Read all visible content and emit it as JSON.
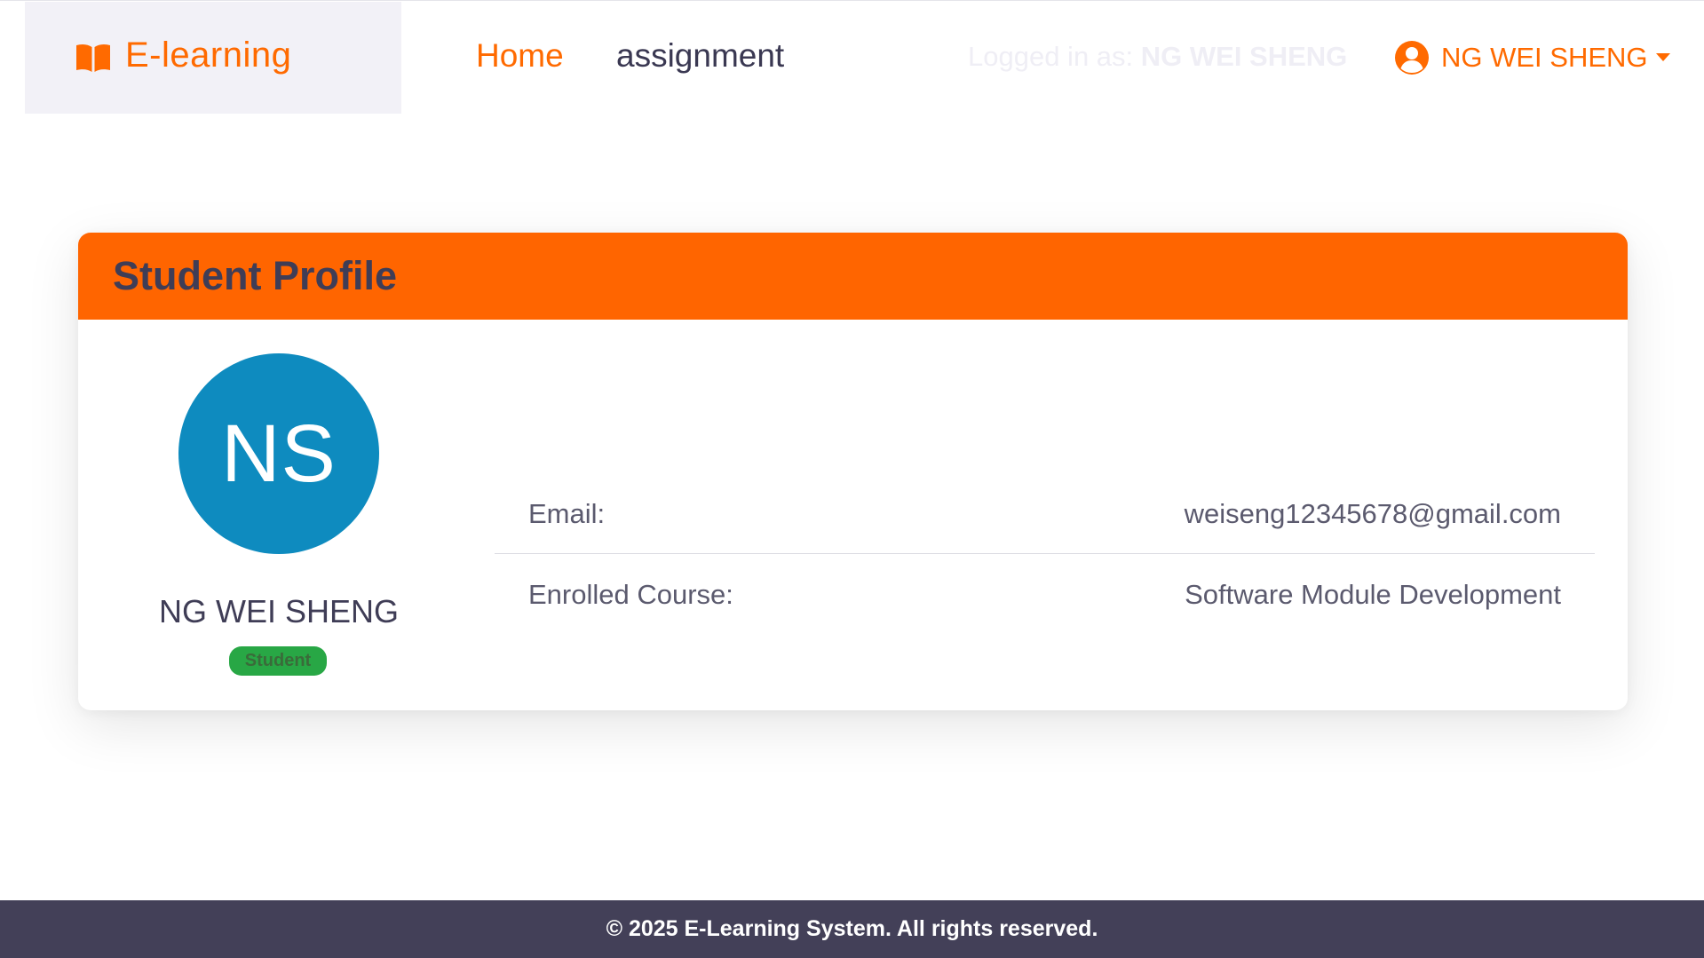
{
  "brand": {
    "name": "E-learning",
    "icon": "book-open-icon"
  },
  "nav": {
    "items": [
      {
        "label": "Home",
        "active": true
      },
      {
        "label": "assignment",
        "active": false
      }
    ]
  },
  "session": {
    "logged_in_prefix": "Logged in as:",
    "logged_in_user": "NG WEI SHENG",
    "user_menu_label": "NG WEI SHENG",
    "user_icon": "user-circle-icon"
  },
  "profile": {
    "title": "Student Profile",
    "initials": "NS",
    "name": "NG WEI SHENG",
    "role": "Student",
    "fields": [
      {
        "label": "Email:",
        "value": "weiseng12345678@gmail.com"
      },
      {
        "label": "Enrolled Course:",
        "value": "Software Module Development"
      }
    ]
  },
  "footer": {
    "text": "© 2025 E-Learning System. All rights reserved."
  },
  "colors": {
    "accent": "#ff6a00",
    "header_bar": "#ff6500",
    "avatar_bg": "#0e8bbf",
    "badge_bg": "#28a745",
    "footer_bg": "#434058",
    "brand_bg": "#f2f1f7"
  }
}
